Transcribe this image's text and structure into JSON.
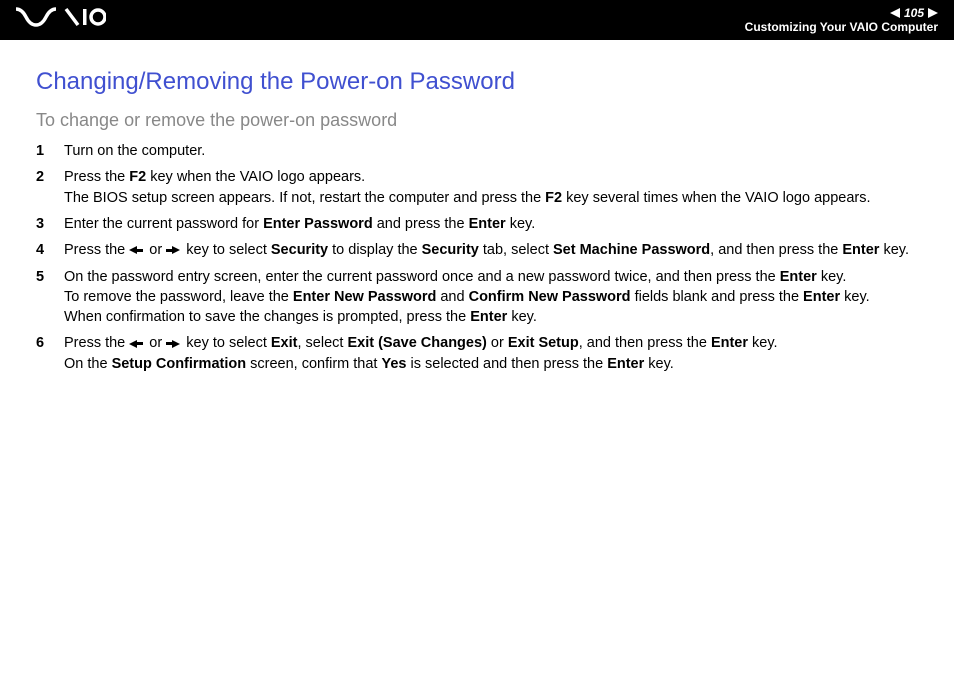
{
  "header": {
    "logo_text": "VAIO",
    "page_number": "105",
    "breadcrumb": "Customizing Your VAIO Computer"
  },
  "content": {
    "title": "Changing/Removing the Power-on Password",
    "subtitle": "To change or remove the power-on password",
    "steps": [
      {
        "num": "1",
        "text_parts": [
          {
            "t": "Turn on the computer."
          }
        ]
      },
      {
        "num": "2",
        "text_parts": [
          {
            "t": "Press the "
          },
          {
            "t": "F2",
            "b": true
          },
          {
            "t": " key when the VAIO logo appears."
          },
          {
            "br": true
          },
          {
            "t": "The BIOS setup screen appears. If not, restart the computer and press the "
          },
          {
            "t": "F2",
            "b": true
          },
          {
            "t": " key several times when the VAIO logo appears."
          }
        ]
      },
      {
        "num": "3",
        "text_parts": [
          {
            "t": "Enter the current password for "
          },
          {
            "t": "Enter Password",
            "b": true
          },
          {
            "t": " and press the "
          },
          {
            "t": "Enter",
            "b": true
          },
          {
            "t": " key."
          }
        ]
      },
      {
        "num": "4",
        "text_parts": [
          {
            "t": "Press the "
          },
          {
            "arrow": "left"
          },
          {
            "t": " or "
          },
          {
            "arrow": "right"
          },
          {
            "t": " key to select "
          },
          {
            "t": "Security",
            "b": true
          },
          {
            "t": " to display the "
          },
          {
            "t": "Security",
            "b": true
          },
          {
            "t": " tab, select "
          },
          {
            "t": "Set Machine Password",
            "b": true
          },
          {
            "t": ", and then press the "
          },
          {
            "t": "Enter",
            "b": true
          },
          {
            "t": " key."
          }
        ]
      },
      {
        "num": "5",
        "text_parts": [
          {
            "t": "On the password entry screen, enter the current password once and a new password twice, and then press the "
          },
          {
            "t": "Enter",
            "b": true
          },
          {
            "t": " key."
          },
          {
            "br": true
          },
          {
            "t": "To remove the password, leave the "
          },
          {
            "t": "Enter New Password",
            "b": true
          },
          {
            "t": " and "
          },
          {
            "t": "Confirm New Password",
            "b": true
          },
          {
            "t": " fields blank and press the "
          },
          {
            "t": "Enter",
            "b": true
          },
          {
            "t": " key."
          },
          {
            "br": true
          },
          {
            "t": "When confirmation to save the changes is prompted, press the "
          },
          {
            "t": "Enter",
            "b": true
          },
          {
            "t": " key."
          }
        ]
      },
      {
        "num": "6",
        "text_parts": [
          {
            "t": "Press the "
          },
          {
            "arrow": "left"
          },
          {
            "t": " or "
          },
          {
            "arrow": "right"
          },
          {
            "t": " key to select "
          },
          {
            "t": "Exit",
            "b": true
          },
          {
            "t": ", select "
          },
          {
            "t": "Exit (Save Changes)",
            "b": true
          },
          {
            "t": " or "
          },
          {
            "t": "Exit Setup",
            "b": true
          },
          {
            "t": ", and then press the "
          },
          {
            "t": "Enter",
            "b": true
          },
          {
            "t": " key."
          },
          {
            "br": true
          },
          {
            "t": "On the "
          },
          {
            "t": "Setup Confirmation",
            "b": true
          },
          {
            "t": " screen, confirm that "
          },
          {
            "t": "Yes",
            "b": true
          },
          {
            "t": " is selected and then press the "
          },
          {
            "t": "Enter",
            "b": true
          },
          {
            "t": " key."
          }
        ]
      }
    ]
  }
}
